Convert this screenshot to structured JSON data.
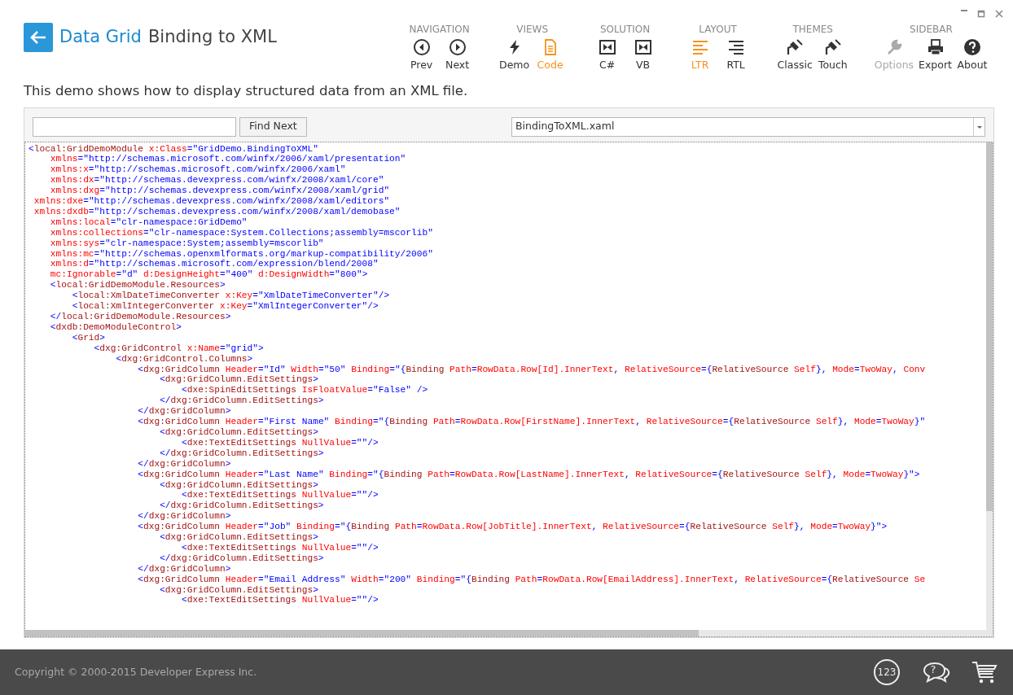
{
  "header": {
    "title_prefix": "Data Grid",
    "title": "Binding to XML"
  },
  "toolbar": [
    {
      "heading": "NAVIGATION",
      "items": [
        {
          "label": "Prev",
          "kind": "prev",
          "selected": false,
          "disabled": false
        },
        {
          "label": "Next",
          "kind": "next",
          "selected": false,
          "disabled": false
        }
      ]
    },
    {
      "heading": "VIEWS",
      "items": [
        {
          "label": "Demo",
          "kind": "bolt",
          "selected": false,
          "disabled": false
        },
        {
          "label": "Code",
          "kind": "document",
          "selected": true,
          "disabled": false
        }
      ]
    },
    {
      "heading": "SOLUTION",
      "items": [
        {
          "label": "C#",
          "kind": "project",
          "selected": false,
          "disabled": false
        },
        {
          "label": "VB",
          "kind": "project",
          "selected": false,
          "disabled": false
        }
      ]
    },
    {
      "heading": "LAYOUT",
      "items": [
        {
          "label": "LTR",
          "kind": "ltr",
          "selected": true,
          "disabled": false
        },
        {
          "label": "RTL",
          "kind": "rtl",
          "selected": false,
          "disabled": false
        }
      ]
    },
    {
      "heading": "THEMES",
      "items": [
        {
          "label": "Classic",
          "kind": "brush",
          "selected": false,
          "disabled": false
        },
        {
          "label": "Touch",
          "kind": "brush",
          "selected": false,
          "disabled": false
        }
      ]
    },
    {
      "heading": "SIDEBAR",
      "items": [
        {
          "label": "Options",
          "kind": "wrench",
          "selected": false,
          "disabled": true
        },
        {
          "label": "Export",
          "kind": "printer",
          "selected": false,
          "disabled": false
        },
        {
          "label": "About",
          "kind": "help",
          "selected": false,
          "disabled": false
        }
      ]
    }
  ],
  "description": "This demo shows how to display structured data from an XML file.",
  "find_button": "Find Next",
  "file_select": {
    "value": "BindingToXML.xaml"
  },
  "code_lines": [
    "<local:GridDemoModule x:Class=\"GridDemo.BindingToXML\"",
    "    xmlns=\"http://schemas.microsoft.com/winfx/2006/xaml/presentation\"",
    "    xmlns:x=\"http://schemas.microsoft.com/winfx/2006/xaml\"",
    "    xmlns:dx=\"http://schemas.devexpress.com/winfx/2008/xaml/core\"",
    "    xmlns:dxg=\"http://schemas.devexpress.com/winfx/2008/xaml/grid\"",
    " xmlns:dxe=\"http://schemas.devexpress.com/winfx/2008/xaml/editors\"",
    " xmlns:dxdb=\"http://schemas.devexpress.com/winfx/2008/xaml/demobase\"",
    "    xmlns:local=\"clr-namespace:GridDemo\"",
    "    xmlns:collections=\"clr-namespace:System.Collections;assembly=mscorlib\"",
    "    xmlns:sys=\"clr-namespace:System;assembly=mscorlib\"",
    "    xmlns:mc=\"http://schemas.openxmlformats.org/markup-compatibility/2006\"",
    "    xmlns:d=\"http://schemas.microsoft.com/expression/blend/2008\"",
    "    mc:Ignorable=\"d\" d:DesignHeight=\"400\" d:DesignWidth=\"800\">",
    "    <local:GridDemoModule.Resources>",
    "        <local:XmlDateTimeConverter x:Key=\"XmlDateTimeConverter\"/>",
    "        <local:XmlIntegerConverter x:Key=\"XmlIntegerConverter\"/>",
    "    </local:GridDemoModule.Resources>",
    "    <dxdb:DemoModuleControl>",
    "        <Grid>",
    "            <dxg:GridControl x:Name=\"grid\">",
    "                <dxg:GridControl.Columns>",
    "                    <dxg:GridColumn Header=\"Id\" Width=\"50\" Binding=\"{Binding Path=RowData.Row[Id].InnerText, RelativeSource={RelativeSource Self}, Mode=TwoWay, Conv",
    "                        <dxg:GridColumn.EditSettings>",
    "                            <dxe:SpinEditSettings IsFloatValue=\"False\" />",
    "                        </dxg:GridColumn.EditSettings>",
    "                    </dxg:GridColumn>",
    "                    <dxg:GridColumn Header=\"First Name\" Binding=\"{Binding Path=RowData.Row[FirstName].InnerText, RelativeSource={RelativeSource Self}, Mode=TwoWay}\"",
    "                        <dxg:GridColumn.EditSettings>",
    "                            <dxe:TextEditSettings NullValue=\"\"/>",
    "                        </dxg:GridColumn.EditSettings>",
    "                    </dxg:GridColumn>",
    "                    <dxg:GridColumn Header=\"Last Name\" Binding=\"{Binding Path=RowData.Row[LastName].InnerText, RelativeSource={RelativeSource Self}, Mode=TwoWay}\">",
    "                        <dxg:GridColumn.EditSettings>",
    "                            <dxe:TextEditSettings NullValue=\"\"/>",
    "                        </dxg:GridColumn.EditSettings>",
    "                    </dxg:GridColumn>",
    "                    <dxg:GridColumn Header=\"Job\" Binding=\"{Binding Path=RowData.Row[JobTitle].InnerText, RelativeSource={RelativeSource Self}, Mode=TwoWay}\">",
    "                        <dxg:GridColumn.EditSettings>",
    "                            <dxe:TextEditSettings NullValue=\"\"/>",
    "                        </dxg:GridColumn.EditSettings>",
    "                    </dxg:GridColumn>",
    "                    <dxg:GridColumn Header=\"Email Address\" Width=\"200\" Binding=\"{Binding Path=RowData.Row[EmailAddress].InnerText, RelativeSource={RelativeSource Se",
    "                        <dxg:GridColumn.EditSettings>",
    "                            <dxe:TextEditSettings NullValue=\"\"/>"
  ],
  "footer": {
    "copyright": "Copyright © 2000-2015 Developer Express Inc.",
    "buttons": [
      {
        "kind": "numbers",
        "text": "123"
      },
      {
        "kind": "help",
        "text": "?"
      },
      {
        "kind": "cart"
      }
    ]
  }
}
